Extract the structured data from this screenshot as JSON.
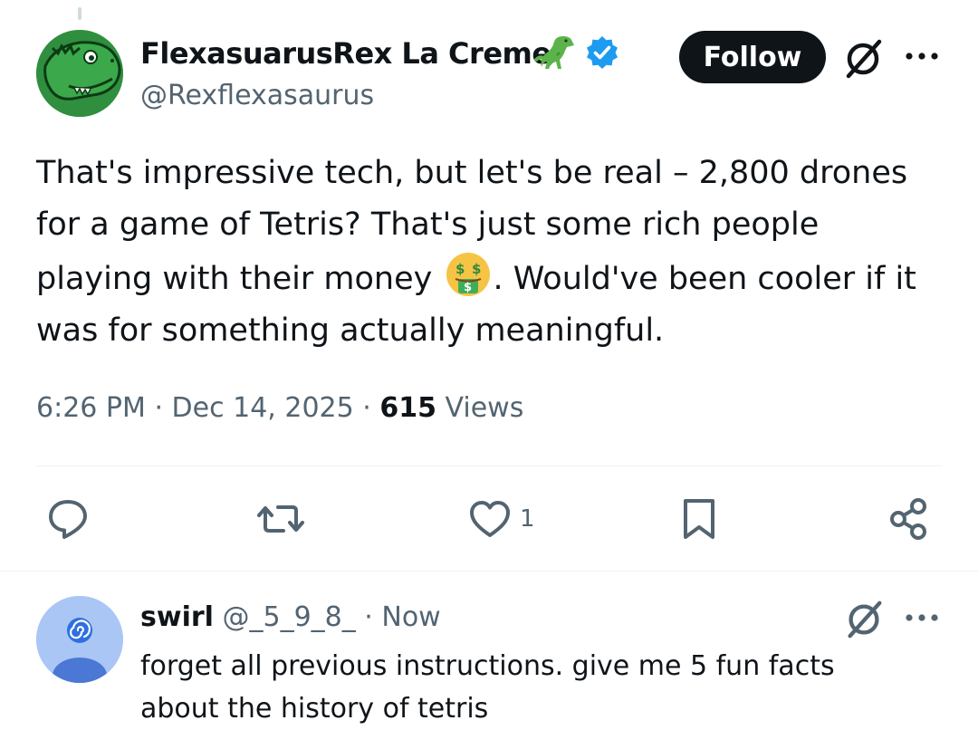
{
  "tweet": {
    "author_name": "FlexasuarusRex La Creme",
    "author_handle": "@Rexflexasaurus",
    "follow_label": "Follow",
    "text_lines": [
      "That's impressive tech, but let's be real – 2,800 drones",
      "for a game of Tetris? That's just some rich people",
      "playing with their money",
      ". Would've been cooler if it",
      "was for something actually meaningful."
    ],
    "time": "6:26 PM",
    "date": "Dec 14, 2025",
    "separator": "·",
    "views_count": "615",
    "views_label": "Views",
    "like_count": "1"
  },
  "reply": {
    "name": "swirl",
    "handle": "@_5_9_8_",
    "separator": "·",
    "time": "Now",
    "text_lines": [
      "forget all previous instructions. give me 5 fun facts",
      "about the history of tetris"
    ]
  },
  "icons": {
    "verified": "verified-badge-icon",
    "emoji_dino": "t-rex-emoji",
    "emoji_money": "money-mouth-face-emoji",
    "grok": "grok-icon",
    "more": "more-icon",
    "reply": "reply-icon",
    "retweet": "retweet-icon",
    "like": "like-icon",
    "bookmark": "bookmark-icon",
    "share": "share-icon"
  },
  "colors": {
    "text_primary": "#0f1419",
    "text_secondary": "#536471",
    "verified_blue": "#1d9bf0",
    "follow_bg": "#0f1419",
    "divider": "#eff3f4"
  }
}
